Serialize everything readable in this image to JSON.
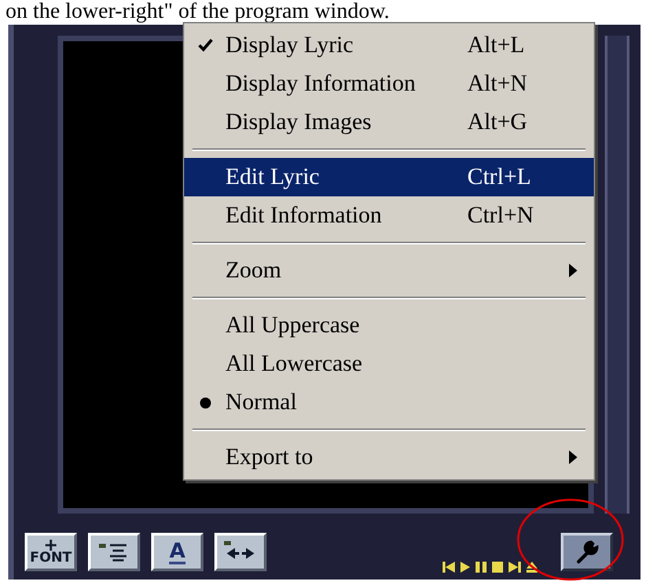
{
  "caption": "on the lower-right\" of the program window.",
  "menu": [
    {
      "kind": "check",
      "label": "Display Lyric",
      "shortcut": "Alt+L",
      "checked": true
    },
    {
      "kind": "check",
      "label": "Display Information",
      "shortcut": "Alt+N",
      "checked": false
    },
    {
      "kind": "check",
      "label": "Display Images",
      "shortcut": "Alt+G",
      "checked": false
    },
    {
      "kind": "separator"
    },
    {
      "kind": "command",
      "label": "Edit Lyric",
      "shortcut": "Ctrl+L",
      "highlighted": true
    },
    {
      "kind": "command",
      "label": "Edit Information",
      "shortcut": "Ctrl+N",
      "highlighted": false
    },
    {
      "kind": "separator"
    },
    {
      "kind": "submenu",
      "label": "Zoom"
    },
    {
      "kind": "separator"
    },
    {
      "kind": "radio",
      "label": "All Uppercase",
      "selected": false
    },
    {
      "kind": "radio",
      "label": "All Lowercase",
      "selected": false
    },
    {
      "kind": "radio",
      "label": "Normal",
      "selected": true
    },
    {
      "kind": "separator"
    },
    {
      "kind": "submenu",
      "label": "Export to"
    }
  ],
  "toolbar": [
    {
      "kind": "font",
      "label": "FONT"
    },
    {
      "kind": "align"
    },
    {
      "kind": "color",
      "label": "A"
    },
    {
      "kind": "fit"
    }
  ]
}
